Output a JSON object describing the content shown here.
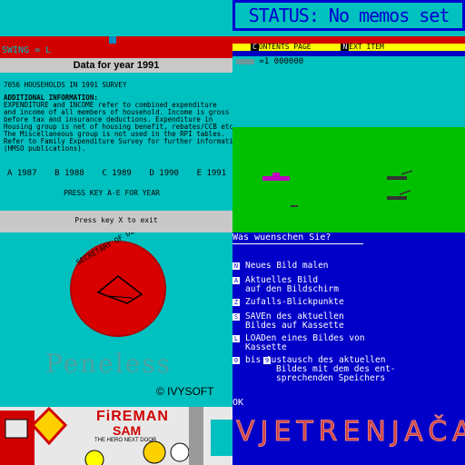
{
  "status": {
    "text": "STATUS: No memos set"
  },
  "survey": {
    "swing": "SWING = L",
    "title": "Data for year 1991",
    "households": "7056 HOUSEHOLDS IN 1991 SURVEY",
    "info_heading": "ADDITIONAL INFORMATION:",
    "info_lines": [
      "EXPENDITURE and INCOME refer to combined expenditure",
      "and income of all members of household. Income is gross -",
      "before tax and insurance deductions. Expenditure in",
      "Housing group is net of housing benefit, rebates/CCB etc.",
      "The Miscellaneous group is not used in the RPI tables.",
      "Refer to Family Expenditure Survey for further information",
      "(HMSO publications)."
    ],
    "years": [
      "A 1987",
      "B 1988",
      "C 1989",
      "D 1990",
      "E 1991"
    ],
    "prompt": "PRESS KEY A-E FOR YEAR",
    "exit": "Press key X to exit"
  },
  "game": {
    "menu_c_key": "C",
    "menu_contents": "ONTENTS PAGE",
    "menu_n_key": "N",
    "menu_next": "EXT ITEM",
    "score_line": "=1 000000"
  },
  "peneless": {
    "title": "Peneless",
    "credit": "© IVYSOFT",
    "seal_text": "SECRETARY OF DEFENSE"
  },
  "menu_de": {
    "prompt": "Was wuenschen Sie?",
    "items": [
      {
        "key": "N",
        "line1": "Neues Bild malen",
        "line2": ""
      },
      {
        "key": "A",
        "line1": "Aktuelles Bild",
        "line2": "auf den Bildschirm"
      },
      {
        "key": "Z",
        "line1": "Zufalls-Blickpunkte",
        "line2": ""
      },
      {
        "key": "S",
        "line1": "SAVEn des aktuellen",
        "line2": "Bildes auf Kassette"
      },
      {
        "key": "L",
        "line1": "LOADen eines Bildes von",
        "line2": "Kassette"
      },
      {
        "key": "0",
        "key2": "9",
        "line1": "bis   Austausch des aktuellen",
        "line2": "Bildes mit dem des ent-",
        "line3": "sprechenden Speichers"
      }
    ],
    "ok": "OK"
  },
  "fireman": {
    "title1": "FiREMAN",
    "title2": "SAM",
    "tagline": "THE HERO NEXT DOOR"
  },
  "vjetrenjaca": {
    "title": "VJETRENJAČA"
  },
  "colors": {
    "cyan": "#00c0c0",
    "blue": "#0000c8",
    "red": "#d00000",
    "yellow": "#ffff00",
    "green": "#00c000"
  }
}
